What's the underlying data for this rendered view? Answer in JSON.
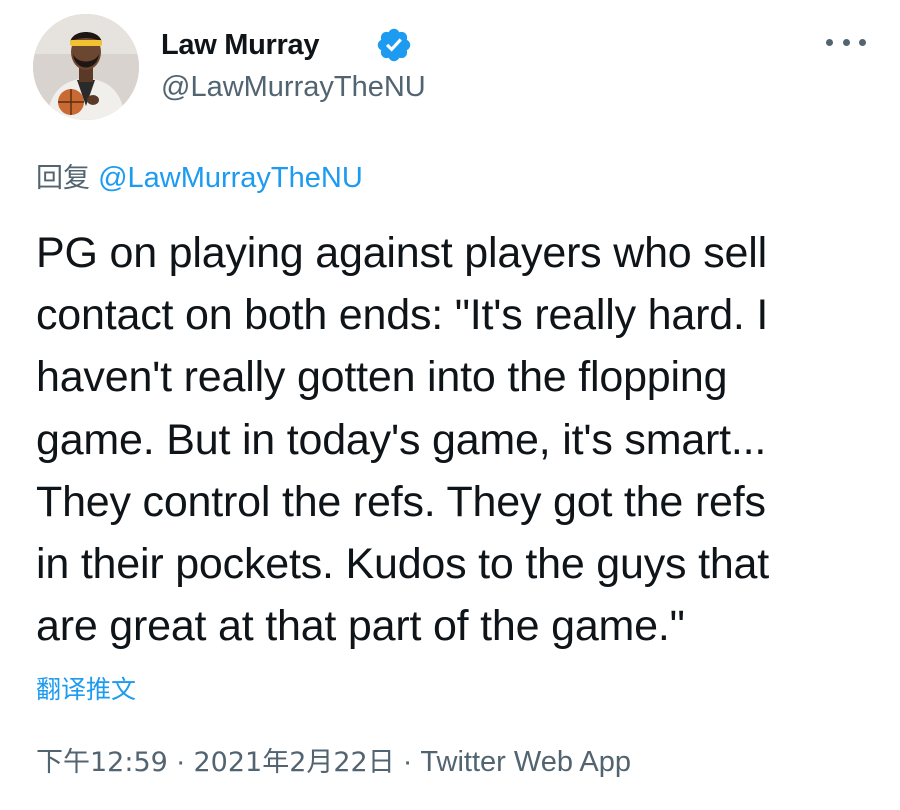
{
  "author": {
    "display_name": "Law Murray",
    "handle": "@LawMurrayTheNU",
    "verified": true,
    "avatar_icon": "profile-photo",
    "verified_icon": "verified-badge-icon"
  },
  "reply": {
    "prefix": "回复",
    "mention": "@LawMurrayTheNU"
  },
  "tweet": {
    "text": "PG on playing against players who sell\ncontact on both ends: \"It's really hard. I\nhaven't really gotten into the flopping\ngame. But in today's game, it's smart...\nThey control the refs. They got the refs\nin their pockets. Kudos to the guys that\nare great at that part of the game.\""
  },
  "actions": {
    "translate_label": "翻译推文",
    "more_icon": "more-options-icon"
  },
  "meta": {
    "time": "下午12:59",
    "separator": "·",
    "date": "2021年2月22日",
    "source": "Twitter Web App"
  },
  "colors": {
    "text_primary": "#0f1419",
    "text_secondary": "#536471",
    "accent": "#1d9bf0"
  }
}
